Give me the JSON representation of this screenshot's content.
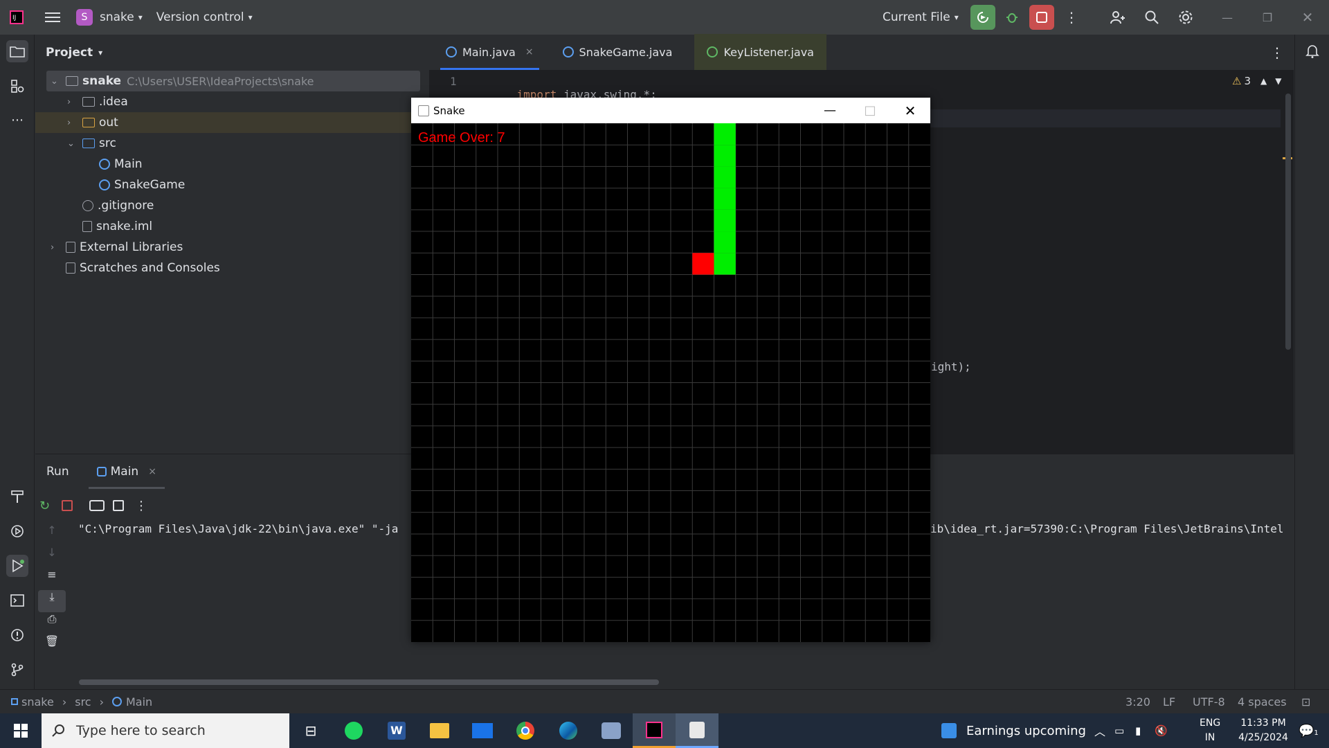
{
  "titlebar": {
    "project_badge": "S",
    "project_name": "snake",
    "vcs": "Version control",
    "run_config": "Current File"
  },
  "project_panel": {
    "title": "Project",
    "tree": [
      {
        "label": "snake",
        "path": "C:\\Users\\USER\\IdeaProjects\\snake",
        "icon": "module-folder-icon",
        "depth": 0,
        "arrow": "down"
      },
      {
        "label": ".idea",
        "icon": "folder-icon",
        "depth": 1,
        "arrow": "right"
      },
      {
        "label": "out",
        "icon": "folder-icon",
        "depth": 1,
        "arrow": "right"
      },
      {
        "label": "src",
        "icon": "folder-icon",
        "depth": 1,
        "arrow": "down"
      },
      {
        "label": "Main",
        "icon": "class-icon",
        "depth": 2,
        "arrow": ""
      },
      {
        "label": "SnakeGame",
        "icon": "class-icon",
        "depth": 2,
        "arrow": ""
      },
      {
        "label": ".gitignore",
        "icon": "ignore-file-icon",
        "depth": 1,
        "arrow": ""
      },
      {
        "label": "snake.iml",
        "icon": "iml-file-icon",
        "depth": 1,
        "arrow": ""
      },
      {
        "label": "External Libraries",
        "icon": "library-icon",
        "depth": 0,
        "arrow": "right"
      },
      {
        "label": "Scratches and Consoles",
        "icon": "scratches-icon",
        "depth": 0,
        "arrow": ""
      }
    ]
  },
  "editor": {
    "tabs": [
      {
        "label": "Main.java",
        "closable": "×"
      },
      {
        "label": "SnakeGame.java"
      },
      {
        "label": "KeyListener.java"
      }
    ],
    "line_number": "1",
    "line1_keyword": "import",
    "line1_rest": " javax.swing.*;",
    "partial_line": "ight);",
    "warnings": "3"
  },
  "run_panel": {
    "title": "Run",
    "tab": "Main",
    "tab_close": "×",
    "console_left": "\"C:\\Program Files\\Java\\jdk-22\\bin\\java.exe\" \"-ja",
    "console_right": "ib\\idea_rt.jar=57390:C:\\Program Files\\JetBrains\\Intel"
  },
  "statusbar": {
    "crumbs": [
      "snake",
      "src",
      "Main"
    ],
    "position": "3:20",
    "line_sep": "LF",
    "encoding": "UTF-8",
    "indent": "4 spaces"
  },
  "snake_window": {
    "title": "Snake",
    "game_over": "Game Over: 7",
    "grid": {
      "cols": 24,
      "rows": 24
    },
    "snake_cells": [
      [
        14,
        0
      ],
      [
        14,
        1
      ],
      [
        14,
        2
      ],
      [
        14,
        3
      ],
      [
        14,
        4
      ],
      [
        14,
        5
      ],
      [
        14,
        6
      ]
    ],
    "food_cell": [
      13,
      6
    ],
    "snake_color": "#00ee00",
    "food_color": "#ff0000",
    "text_color": "#ff0000"
  },
  "taskbar": {
    "search_placeholder": "Type here to search",
    "news": "Earnings upcoming",
    "lang1": "ENG",
    "lang2": "IN",
    "time": "11:33 PM",
    "date": "4/25/2024",
    "notif_count": "1"
  }
}
